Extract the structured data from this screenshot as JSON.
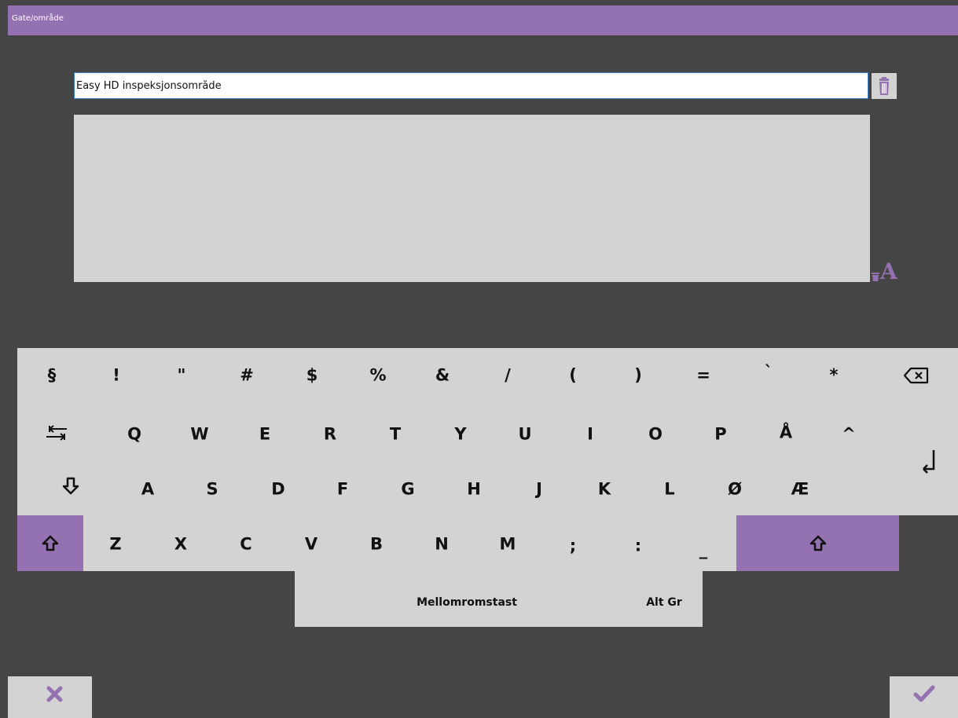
{
  "window": {
    "title": "Gate/område"
  },
  "input": {
    "value": "Easy HD inspeksjonsområde"
  },
  "keyboard": {
    "row1": [
      "§",
      "!",
      "\"",
      "#",
      "$",
      "%",
      "&",
      "/",
      "(",
      ")",
      "=",
      "`",
      "*"
    ],
    "row2": [
      "Q",
      "W",
      "E",
      "R",
      "T",
      "Y",
      "U",
      "I",
      "O",
      "P",
      "Å",
      "^"
    ],
    "row3": [
      "A",
      "S",
      "D",
      "F",
      "G",
      "H",
      "J",
      "K",
      "L",
      "Ø",
      "Æ"
    ],
    "row4": [
      "Z",
      "X",
      "C",
      "V",
      "B",
      "N",
      "M",
      ";",
      ":",
      "_"
    ],
    "space_label": "Mellomromstast",
    "altgr_label": "Alt Gr"
  },
  "icons": {
    "trash": "trash-icon",
    "clear_format": "clear-format-icon",
    "backspace": "backspace-icon",
    "tab": "tab-icon",
    "enter": "enter-icon",
    "caps_lock": "caps-lock-icon",
    "shift": "shift-icon",
    "cancel": "close-icon",
    "confirm": "checkmark-icon"
  },
  "colors": {
    "accent": "#9471b1",
    "background": "#454545",
    "key_surface": "#d3d3d3",
    "input_border": "#3a7fc9"
  }
}
